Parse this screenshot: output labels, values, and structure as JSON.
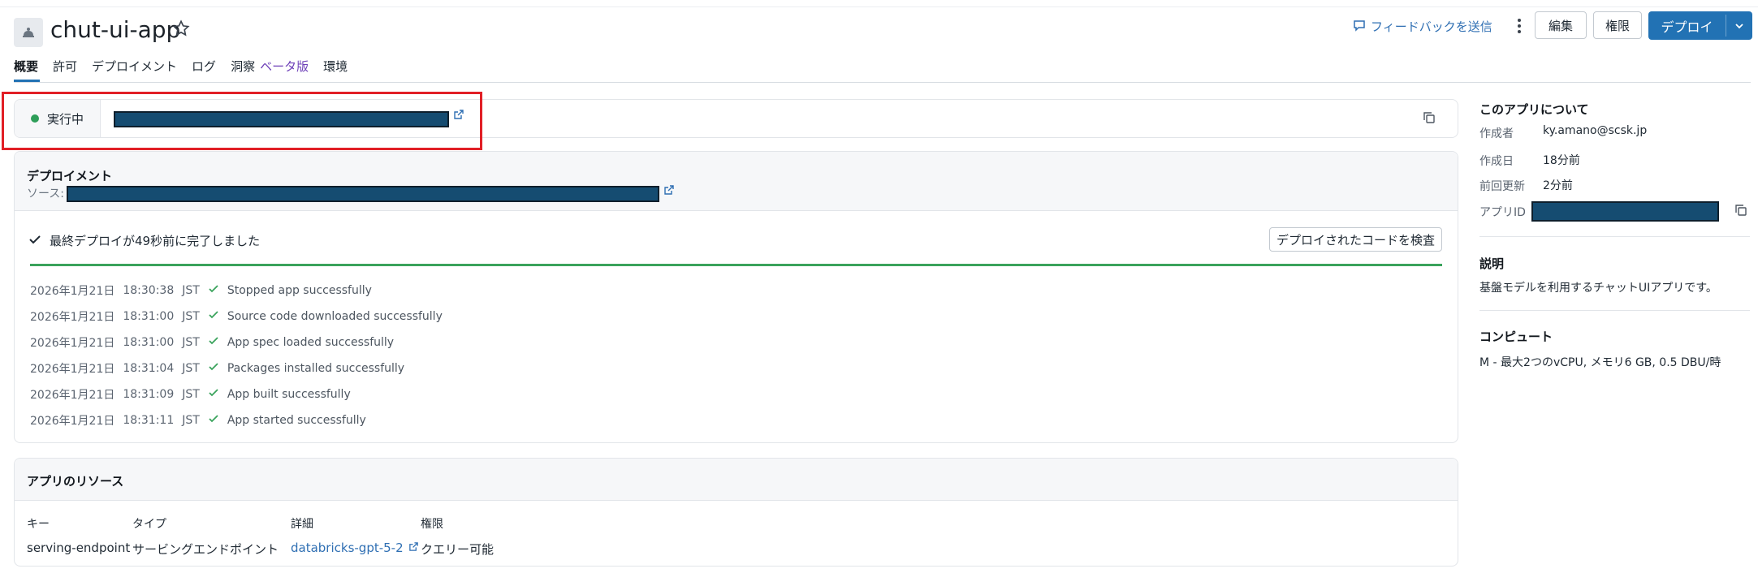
{
  "app": {
    "title": "chut-ui-app"
  },
  "header": {
    "feedback_label": "フィードバックを送信",
    "edit_label": "編集",
    "permissions_label": "権限",
    "deploy_label": "デプロイ"
  },
  "tabs": [
    {
      "label": "概要"
    },
    {
      "label": "許可"
    },
    {
      "label": "デプロイメント"
    },
    {
      "label": "ログ"
    },
    {
      "label": "洞察",
      "badge": "ベータ版"
    },
    {
      "label": "環境"
    }
  ],
  "status": {
    "label": "実行中",
    "color": "#2e9e59"
  },
  "deployment": {
    "title": "デプロイメント",
    "source_label": "ソース:",
    "result_text": "最終デプロイが49秒前に完了しました",
    "inspect_button": "デプロイされたコードを検査",
    "logs": [
      {
        "date": "2026年1月21日",
        "time": "18:30:38",
        "tz": "JST",
        "message": "Stopped app successfully"
      },
      {
        "date": "2026年1月21日",
        "time": "18:31:00",
        "tz": "JST",
        "message": "Source code downloaded successfully"
      },
      {
        "date": "2026年1月21日",
        "time": "18:31:00",
        "tz": "JST",
        "message": "App spec loaded successfully"
      },
      {
        "date": "2026年1月21日",
        "time": "18:31:04",
        "tz": "JST",
        "message": "Packages installed successfully"
      },
      {
        "date": "2026年1月21日",
        "time": "18:31:09",
        "tz": "JST",
        "message": "App built successfully"
      },
      {
        "date": "2026年1月21日",
        "time": "18:31:11",
        "tz": "JST",
        "message": "App started successfully"
      }
    ]
  },
  "resources": {
    "title": "アプリのリソース",
    "columns": [
      "キー",
      "タイプ",
      "詳細",
      "権限"
    ],
    "rows": [
      {
        "key": "serving-endpoint",
        "type": "サービングエンドポイント",
        "detail": "databricks-gpt-5-2",
        "permission": "クエリー可能"
      }
    ]
  },
  "about": {
    "title": "このアプリについて",
    "creator_label": "作成者",
    "creator": "ky.amano@scsk.jp",
    "created_label": "作成日",
    "created": "18分前",
    "updated_label": "前回更新",
    "updated": "2分前",
    "app_id_label": "アプリID",
    "description_title": "説明",
    "description": "基盤モデルを利用するチャットUIアプリです。",
    "compute_title": "コンピュート",
    "compute": "M - 最大2つのvCPU, メモリ6 GB, 0.5 DBU/時"
  },
  "colors": {
    "accent": "#2272b4",
    "success": "#3aa35c",
    "highlight": "#e11f26",
    "redaction": "#154c71"
  }
}
